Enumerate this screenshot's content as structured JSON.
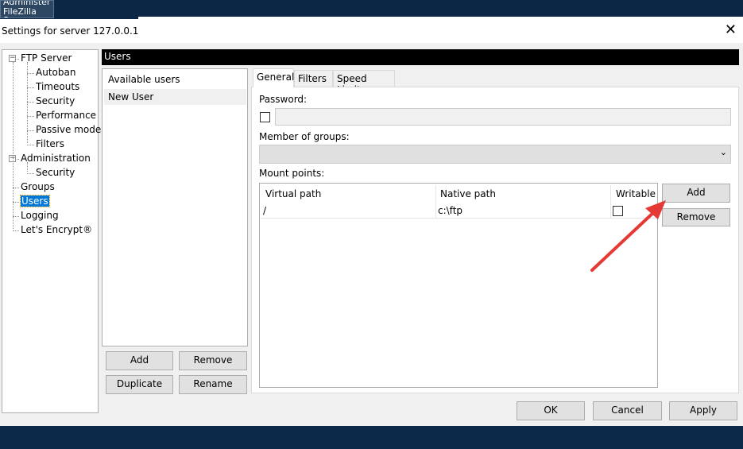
{
  "taskbar": {
    "tile_line1": "Administer",
    "tile_line2": "FileZilla S..."
  },
  "dialog": {
    "title": "Settings for server 127.0.0.1",
    "close": "✕"
  },
  "tree": [
    {
      "label": "FTP Server",
      "level": 0,
      "expander": "−"
    },
    {
      "label": "Autoban",
      "level": 1
    },
    {
      "label": "Timeouts",
      "level": 1
    },
    {
      "label": "Security",
      "level": 1
    },
    {
      "label": "Performance",
      "level": 1
    },
    {
      "label": "Passive mode",
      "level": 1
    },
    {
      "label": "Filters",
      "level": 1
    },
    {
      "label": "Administration",
      "level": 0,
      "expander": "−"
    },
    {
      "label": "Security",
      "level": 1
    },
    {
      "label": "Groups",
      "level": 0
    },
    {
      "label": "Users",
      "level": 0,
      "selected": true
    },
    {
      "label": "Logging",
      "level": 0
    },
    {
      "label": "Let's Encrypt®",
      "level": 0
    }
  ],
  "section_header": "Users",
  "users": {
    "header": "Available users",
    "items": [
      "New User"
    ],
    "add": "Add",
    "remove": "Remove",
    "duplicate": "Duplicate",
    "rename": "Rename"
  },
  "tabs": [
    "General",
    "Filters",
    "Speed Limits"
  ],
  "general": {
    "password_label": "Password:",
    "password_value": "",
    "groups_label": "Member of groups:",
    "groups_value": "",
    "mount_label": "Mount points:",
    "columns": [
      "Virtual path",
      "Native path",
      "Writable"
    ],
    "rows": [
      {
        "virtual": "/",
        "native": "c:\\ftp",
        "writable": false
      }
    ],
    "add": "Add",
    "remove": "Remove"
  },
  "footer": {
    "ok": "OK",
    "cancel": "Cancel",
    "apply": "Apply"
  },
  "colors": {
    "accent": "#0078d7",
    "arrow": "#e53935"
  }
}
